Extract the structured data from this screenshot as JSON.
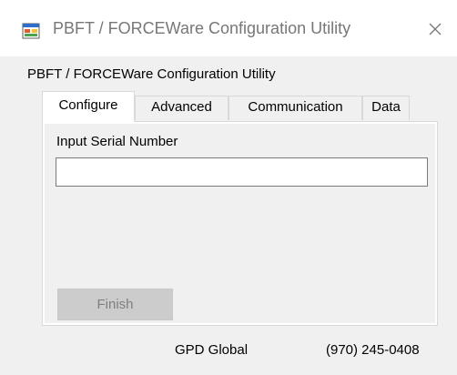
{
  "window": {
    "title": "PBFT / FORCEWare Configuration Utility",
    "icon": "application-window-icon",
    "close_icon": "close-icon"
  },
  "header": {
    "subtitle": "PBFT / FORCEWare Configuration Utility"
  },
  "tabs": [
    {
      "label": "Configure",
      "active": true
    },
    {
      "label": "Advanced",
      "active": false
    },
    {
      "label": "Communication",
      "active": false
    },
    {
      "label": "Data",
      "active": false
    }
  ],
  "configure_panel": {
    "serial_label": "Input Serial Number",
    "serial_value": "",
    "finish_label": "Finish",
    "finish_enabled": false
  },
  "footer": {
    "company": "GPD Global",
    "phone": "(970) 245-0408"
  },
  "colors": {
    "window_background": "#f0f0f0",
    "title_text": "#777777",
    "disabled_button": "#cccccc"
  }
}
